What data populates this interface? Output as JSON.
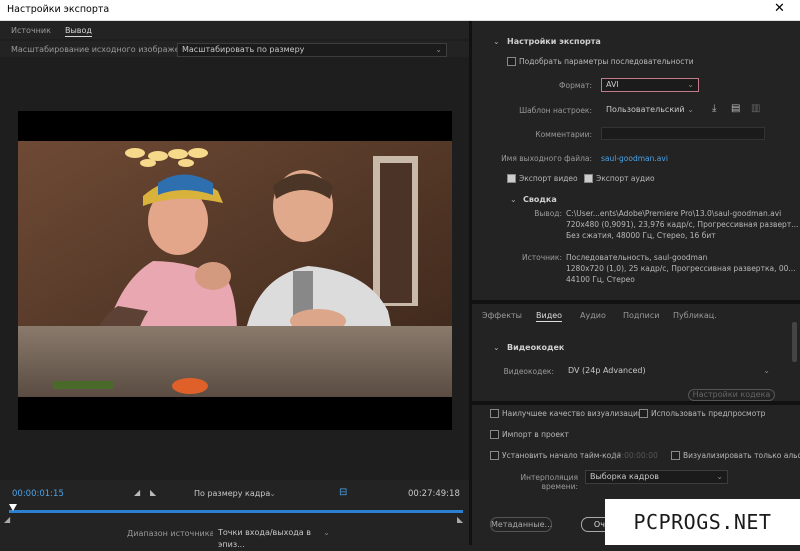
{
  "window": {
    "title": "Настройки экспорта",
    "close": "✕"
  },
  "left": {
    "tabs": [
      "Источник",
      "Вывод"
    ],
    "scaling_label": "Масштабирование исходного изображения:",
    "scaling_value": "Масштабировать по размеру",
    "timecode_in": "00:00:01:15",
    "timecode_out": "00:27:49:18",
    "fit_value": "По размеру кадра",
    "source_range_label": "Диапазон источника:",
    "source_range_value": "Точки входа/выхода в эпиз..."
  },
  "export": {
    "section_title": "Настройки экспорта",
    "match_sequence": "Подобрать параметры последовательности",
    "format_label": "Формат:",
    "format_value": "AVI",
    "preset_label": "Шаблон настроек:",
    "preset_value": "Пользовательский",
    "comments_label": "Комментарии:",
    "output_name_label": "Имя выходного файла:",
    "output_name_value": "saul-goodman.avi",
    "export_video": "Экспорт видео",
    "export_audio": "Экспорт аудио"
  },
  "summary": {
    "title": "Сводка",
    "output_label": "Вывод:",
    "output_lines": [
      "C:\\User...ents\\Adobe\\Premiere Pro\\13.0\\saul-goodman.avi",
      "720x480 (0,9091), 23,976 кадр/с, Прогрессивная разверт...",
      "Без сжатия, 48000 Гц, Стерео, 16 бит"
    ],
    "source_label": "Источник:",
    "source_lines": [
      "Последовательность, saul-goodman",
      "1280x720 (1,0), 25 кадр/с, Прогрессивная развертка, 00...",
      "44100 Гц, Стерео"
    ]
  },
  "bottom_tabs": [
    "Эффекты",
    "Видео",
    "Аудио",
    "Подписи",
    "Публикац."
  ],
  "codec": {
    "section": "Видеокодек",
    "label": "Видеокодек:",
    "value": "DV (24p Advanced)",
    "settings_btn": "Настройки кодека"
  },
  "options": {
    "max_quality": "Наилучшее качество визуализации",
    "use_previews": "Использовать предпросмотр",
    "import_project": "Импорт в проект",
    "set_start_tc": "Установить начало тайм-кода",
    "start_tc_value": "00:00:00:00",
    "render_alpha": "Визуализировать только альфа-",
    "interp_label": "Интерполяция времени:",
    "interp_value": "Выборка кадров"
  },
  "buttons": {
    "metadata": "Метаданные...",
    "queue": "Очередь"
  },
  "watermark": "PCPROGS.NET"
}
